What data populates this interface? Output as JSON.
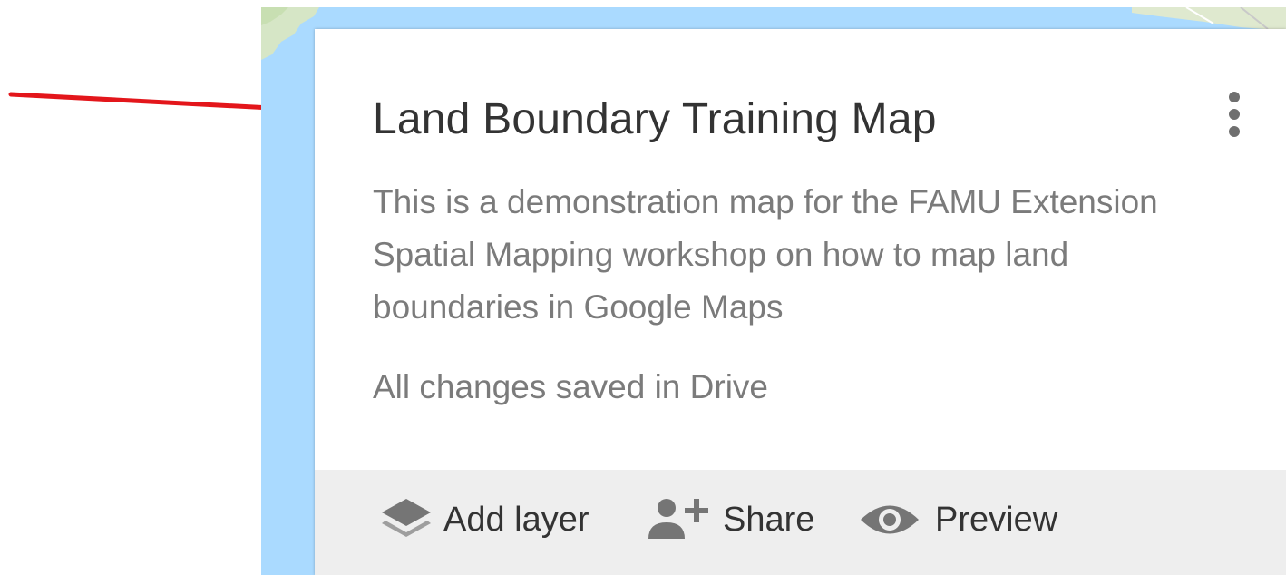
{
  "map_panel": {
    "title": "Land Boundary Training Map",
    "more_options_icon": "more-vert-icon",
    "description": "This is a demonstration map for the FAMU Extension Spatial Mapping workshop on how to map land boundaries in Google Maps",
    "save_status": "All changes saved in Drive"
  },
  "toolbar": {
    "add_layer": {
      "label": "Add layer",
      "icon": "layers-icon"
    },
    "share": {
      "label": "Share",
      "icon": "person-add-icon"
    },
    "preview": {
      "label": "Preview",
      "icon": "eye-icon"
    }
  },
  "annotation": {
    "arrow_color": "#e3161b",
    "arrow_icon": "arrow-right-icon"
  },
  "colors": {
    "map_water": "#aadaff",
    "panel_bg": "#ffffff",
    "toolbar_bg": "#eeeeee",
    "title_text": "#333333",
    "secondary_text": "#7b7b7b"
  }
}
